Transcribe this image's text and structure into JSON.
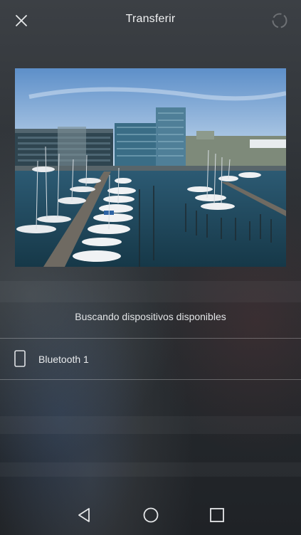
{
  "header": {
    "title": "Transferir"
  },
  "icons": {
    "close": "close-icon",
    "refresh": "refresh-spinner-icon",
    "device": "phone-icon",
    "back": "back-triangle-icon",
    "home": "home-circle-icon",
    "recents": "recents-square-icon"
  },
  "preview": {
    "description_icon": "image-thumbnail"
  },
  "status": {
    "text": "Buscando dispositivos disponibles"
  },
  "devices": [
    {
      "label": "Bluetooth 1"
    }
  ],
  "colors": {
    "text_primary": "#f1f2f3",
    "icon": "#e6e8ea",
    "spinner": "#7d8084",
    "divider": "rgba(255,255,255,0.28)"
  }
}
